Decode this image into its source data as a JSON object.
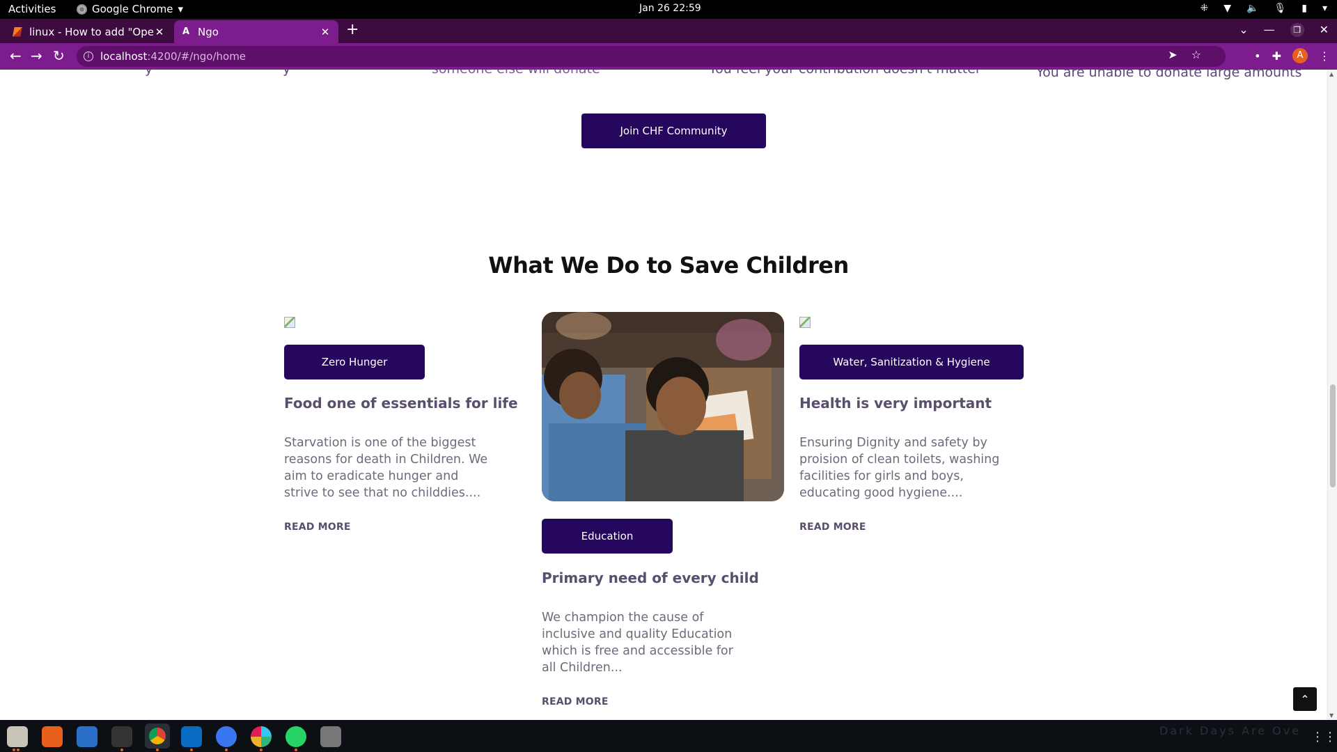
{
  "system": {
    "activities": "Activities",
    "app_name": "Google Chrome",
    "clock": "Jan 26  22:59"
  },
  "browser": {
    "tabs": [
      {
        "title": "linux - How to add \"Open",
        "active": false
      },
      {
        "title": "Ngo",
        "active": true
      }
    ],
    "url_host": "localhost",
    "url_path": ":4200/#/ngo/home"
  },
  "page": {
    "clipped_texts": [
      "y",
      "y",
      "someone else will donate",
      "You feel your contribution doesn't matter",
      "You are unable to donate large amounts"
    ],
    "join_button": "Join CHF Community",
    "section_title": "What We Do to Save Children",
    "cards": [
      {
        "tag": "Zero Hunger",
        "heading": "Food one of essentials for life",
        "text": "Starvation is one of the biggest reasons for death in Children. We aim to eradicate hunger and strive to see that no childdies....",
        "read_more": "READ MORE"
      },
      {
        "tag": "Education",
        "heading": "Primary need of every child",
        "text": "We champion the cause of inclusive and quality Education which is free and accessible for all Children...",
        "read_more": "READ MORE"
      },
      {
        "tag": "Water, Sanitization & Hygiene",
        "heading": "Health is very important",
        "text": "Ensuring Dignity and safety by proision of clean toilets, washing facilities for girls and boys, educating good hygiene....",
        "read_more": "READ MORE"
      }
    ]
  },
  "dock": {
    "apps": [
      "files-icon",
      "software-icon",
      "writer-icon",
      "terminal-icon",
      "chrome-icon",
      "vscode-icon",
      "signal-icon",
      "slack-icon",
      "whatsapp-icon",
      "usb-icon"
    ],
    "wallpaper_text": "Dark Days Are Ove"
  }
}
